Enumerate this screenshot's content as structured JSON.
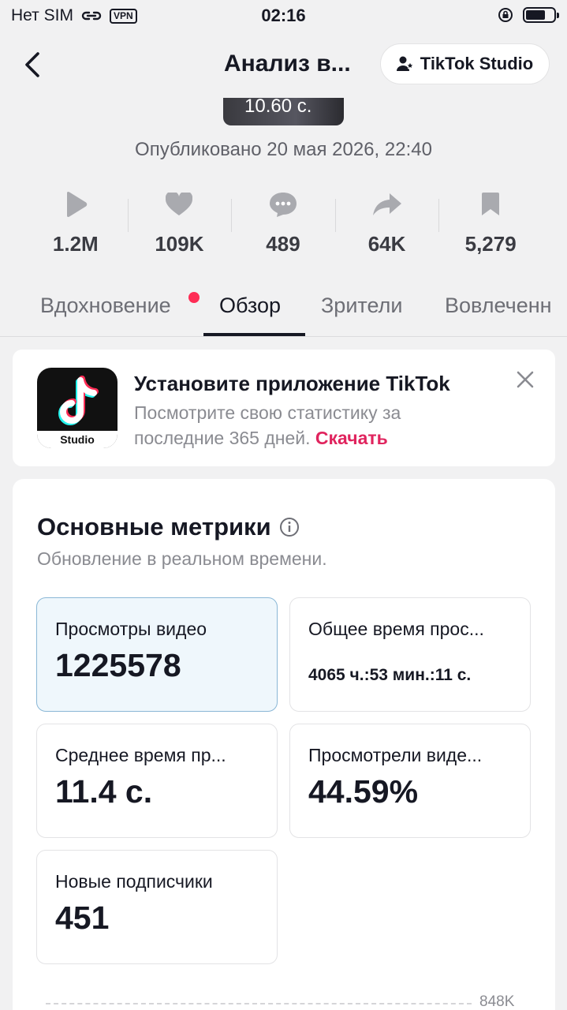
{
  "status_bar": {
    "carrier": "Нет SIM",
    "vpn": "VPN",
    "time": "02:16"
  },
  "header": {
    "title": "Анализ в...",
    "studio_button": "TikTok Studio"
  },
  "video": {
    "duration": "10.60 с.",
    "published": "Опубликовано 20 мая 2026, 22:40"
  },
  "stats": [
    {
      "icon": "play-icon",
      "value": "1.2M"
    },
    {
      "icon": "heart-icon",
      "value": "109K"
    },
    {
      "icon": "comment-icon",
      "value": "489"
    },
    {
      "icon": "share-icon",
      "value": "64K"
    },
    {
      "icon": "bookmark-icon",
      "value": "5,279"
    }
  ],
  "tabs": [
    {
      "label": "Вдохновение",
      "badge": true
    },
    {
      "label": "Обзор",
      "active": true
    },
    {
      "label": "Зрители"
    },
    {
      "label": "Вовлеченн"
    }
  ],
  "banner": {
    "title": "Установите приложение TikTok",
    "text": "Посмотрите свою статистику за последние 365 дней.",
    "link": "Скачать",
    "app_label": "Studio"
  },
  "metrics": {
    "title": "Основные метрики",
    "subtitle": "Обновление в реальном времени.",
    "tiles": [
      {
        "label": "Просмотры видео",
        "value": "1225578"
      },
      {
        "label": "Общее время прос...",
        "value": "4065 ч.:53 мин.:11 с."
      },
      {
        "label": "Среднее время пр...",
        "value": "11.4 с."
      },
      {
        "label": "Просмотрели виде...",
        "value": "44.59%"
      },
      {
        "label": "Новые подписчики",
        "value": "451"
      }
    ],
    "chart_top_label": "848K"
  },
  "colors": {
    "accent": "#fe2c55",
    "link": "#e0245e",
    "selected_tile": "#eff7fc"
  }
}
